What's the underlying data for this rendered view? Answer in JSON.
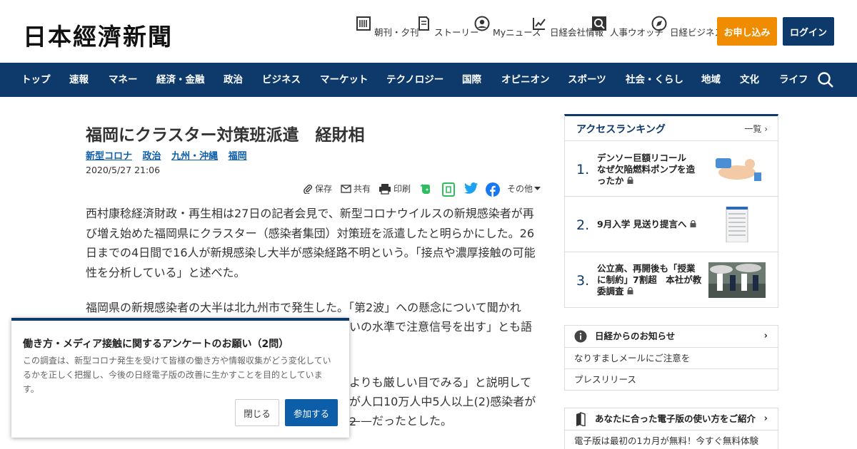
{
  "header": {
    "logo": "日本經濟新聞",
    "tools": [
      {
        "label": "朝刊・夕刊",
        "icon": "newspaper-icon"
      },
      {
        "label": "ストーリー",
        "icon": "story-icon"
      },
      {
        "label": "Myニュース",
        "icon": "user-icon"
      },
      {
        "label": "日経会社情報",
        "icon": "chart-icon"
      },
      {
        "label": "人事ウオッチ",
        "icon": "search-person-icon"
      },
      {
        "label": "日経ビジネス",
        "icon": "compass-icon"
      }
    ],
    "apply_label": "お申し込み",
    "login_label": "ログイン",
    "colors": {
      "nav": "#0d3a6b",
      "apply": "#f08c00",
      "link": "#0d5ea8"
    }
  },
  "nav": {
    "items": [
      "トップ",
      "速報",
      "マネー",
      "経済・金融",
      "政治",
      "ビジネス",
      "マーケット",
      "テクノロジー",
      "国際",
      "オピニオン",
      "スポーツ",
      "社会・くらし",
      "地域",
      "文化",
      "ライフ"
    ],
    "search_icon": "search-icon"
  },
  "article": {
    "title": "福岡にクラスター対策班派遣　経財相",
    "tags": [
      "新型コロナ",
      "政治",
      "九州・沖縄",
      "福岡"
    ],
    "date": "2020/5/27 21:06",
    "share": {
      "save": "保存",
      "share": "共有",
      "print": "印刷",
      "more": "その他"
    },
    "paragraphs": [
      "西村康稔経済財政・再生相は27日の記者会見で、新型コロナウイルスの新規感染者が再び増え始めた福岡県にクラスター（感染者集団）対策班を派遣したと明らかにした。26日までの4日間で16人が新規感染し大半が感染経路不明という。「接点や濃厚接触の可能性を分析している」と述べた。",
      "福岡県の新規感染者の大半は北九州市で発生した。「第2波」への懸念について聞かれ",
      "いの水準で注意信号を出す」とも語",
      "よりも厳しい目でみる」と説明して",
      "が人口10万人中5人以上(2)感染者が2",
      "だったとした。"
    ]
  },
  "ranking": {
    "heading": "アクセスランキング",
    "all_label": "一覧",
    "items": [
      {
        "rank": "1.",
        "title": "デンソー巨額リコール　なぜ欠陥燃料ポンプを造ったか"
      },
      {
        "rank": "2.",
        "title": "9月入学 見送り提言へ"
      },
      {
        "rank": "3.",
        "title": "公立高、再開後も「授業に制約」7割超　本社が教委調査"
      }
    ]
  },
  "info": {
    "heading": "日経からのお知らせ",
    "items": [
      "なりすましメールにご注意を",
      "プレスリリース"
    ]
  },
  "guide": {
    "heading": "あなたに合った電子版の使い方をご紹介",
    "text": "電子版は最初の1カ月が無料！今すぐ無料体験"
  },
  "survey": {
    "title": "働き方・メディア接触に関するアンケートのお願い（2問）",
    "description": "この調査は、新型コロナ発生を受けて皆様の働き方や情報収集がどう変化しているかを正しく把握し、今後の日経電子版の改善に生かすことを目的としています。",
    "close_label": "閉じる",
    "join_label": "参加する"
  }
}
